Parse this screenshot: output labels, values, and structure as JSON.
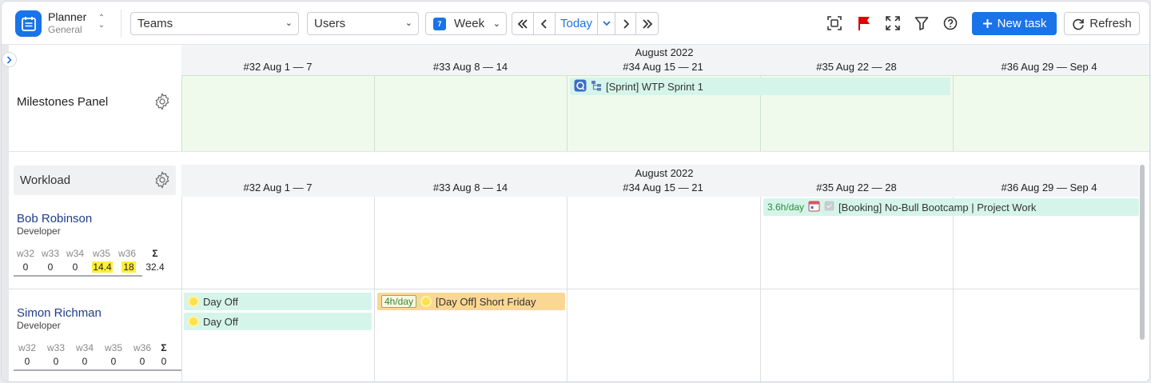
{
  "app": {
    "title": "Planner",
    "subtitle": "General"
  },
  "toolbar": {
    "teams_select": "Teams",
    "users_select": "Users",
    "view_select": "Week",
    "calendar_day": "7",
    "today_label": "Today",
    "new_task_label": "New task",
    "refresh_label": "Refresh"
  },
  "timeline": {
    "month": "August 2022",
    "weeks": [
      "#32 Aug 1 — 7",
      "#33 Aug 8 — 14",
      "#34 Aug 15 — 21",
      "#35 Aug 22 — 28",
      "#36 Aug 29 — Sep 4"
    ]
  },
  "milestones": {
    "label": "Milestones Panel",
    "items": [
      {
        "title": "[Sprint] WTP Sprint 1"
      }
    ]
  },
  "workload": {
    "label": "Workload",
    "users": [
      {
        "name": "Bob Robinson",
        "role": "Developer",
        "week_labels": [
          "w32",
          "w33",
          "w34",
          "w35",
          "w36",
          "Σ"
        ],
        "week_values": [
          "0",
          "0",
          "0",
          "14.4",
          "18",
          "32.4"
        ],
        "tasks": [
          {
            "rate": "3.6h/day",
            "title": "[Booking] No-Bull Bootcamp | Project Work"
          }
        ]
      },
      {
        "name": "Simon Richman",
        "role": "Developer",
        "week_labels": [
          "w32",
          "w33",
          "w34",
          "w35",
          "w36",
          "Σ"
        ],
        "week_values": [
          "0",
          "0",
          "0",
          "0",
          "0",
          "0"
        ],
        "tasks": [
          {
            "title": "Day Off"
          },
          {
            "title": "Day Off"
          },
          {
            "rate": "4h/day",
            "title": "[Day Off] Short Friday"
          }
        ]
      }
    ]
  },
  "colors": {
    "accent": "#1a73e8",
    "milestone_bg": "#effaed",
    "task_mint": "#d6f5ea",
    "task_orange": "#fbd796",
    "highlight": "#ffee3b",
    "flag": "#e00000"
  }
}
